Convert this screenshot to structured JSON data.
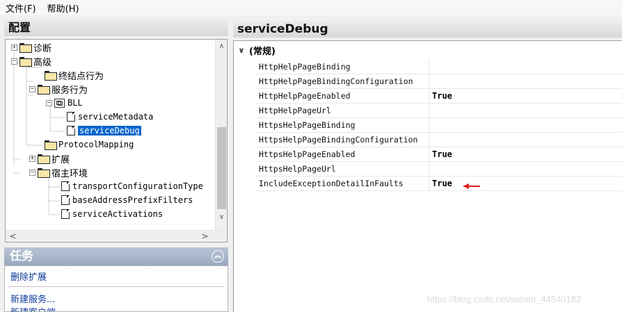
{
  "menu": {
    "file": "文件(F)",
    "help": "帮助(H)"
  },
  "left_panel": {
    "title": "配置"
  },
  "right_panel": {
    "title": "serviceDebug"
  },
  "tree": {
    "diagnostics": "诊断",
    "advanced": "高级",
    "endpoint_behaviors": "终结点行为",
    "service_behaviors": "服务行为",
    "bll": "BLL",
    "service_metadata": "serviceMetadata",
    "service_debug": "serviceDebug",
    "protocol_mapping": "ProtocolMapping",
    "extensions": "扩展",
    "hosting_env": "宿主环境",
    "transport_config_types": "transportConfigurationType",
    "base_address_prefix_filters": "baseAddressPrefixFilters",
    "service_activations": "serviceActivations"
  },
  "tasks": {
    "title": "任务",
    "items": [
      "删除扩展",
      "新建服务...",
      "新建客户端"
    ]
  },
  "properties": {
    "category": "(常规)",
    "rows": [
      {
        "name": "HttpHelpPageBinding",
        "value": ""
      },
      {
        "name": "HttpHelpPageBindingConfiguration",
        "value": ""
      },
      {
        "name": "HttpHelpPageEnabled",
        "value": "True"
      },
      {
        "name": "HttpHelpPageUrl",
        "value": ""
      },
      {
        "name": "HttpsHelpPageBinding",
        "value": ""
      },
      {
        "name": "HttpsHelpPageBindingConfiguration",
        "value": ""
      },
      {
        "name": "HttpsHelpPageEnabled",
        "value": "True"
      },
      {
        "name": "HttpsHelpPageUrl",
        "value": ""
      },
      {
        "name": "IncludeExceptionDetailInFaults",
        "value": "True"
      }
    ]
  },
  "watermark": "https://blog.csdn.net/weixin_44540183",
  "colors": {
    "selection": "#0a66cc",
    "annotation_arrow": "#e02020",
    "task_link": "#0b3a9b"
  }
}
